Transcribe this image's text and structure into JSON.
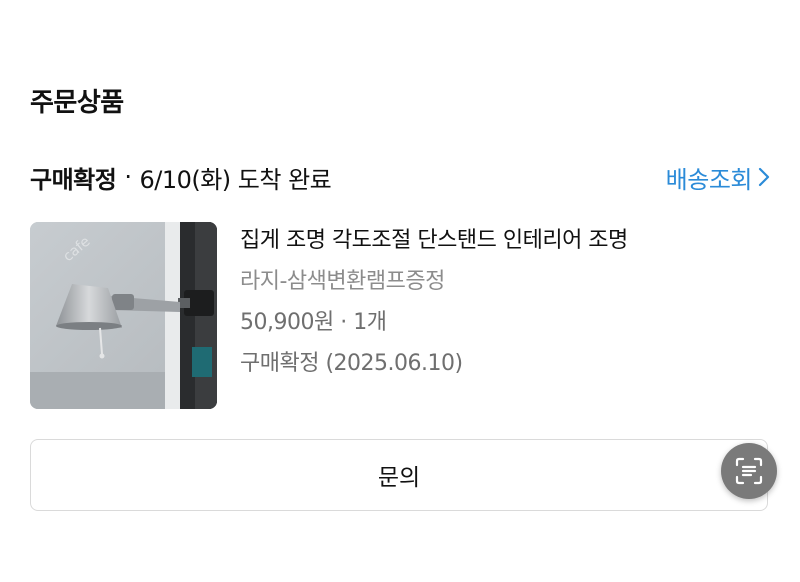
{
  "section": {
    "title": "주문상품"
  },
  "order": {
    "status": "구매확정",
    "separator": "·",
    "delivery_info": "6/10(화) 도착 완료",
    "track_label": "배송조회"
  },
  "product": {
    "name": "집게 조명 각도조절 단스탠드 인테리어 조명",
    "option": "라지-삼색변환램프증정",
    "price_qty": "50,900원 · 1개",
    "confirm_status": "구매확정 (2025.06.10)",
    "image_icon": "clamp-lamp-photo"
  },
  "actions": {
    "inquiry_label": "문의",
    "scan_icon": "text-scan-icon"
  },
  "colors": {
    "link": "#2b8bd8",
    "muted_text": "#8c8c8c",
    "border": "#dadada",
    "fab": "#7a7a7a"
  }
}
